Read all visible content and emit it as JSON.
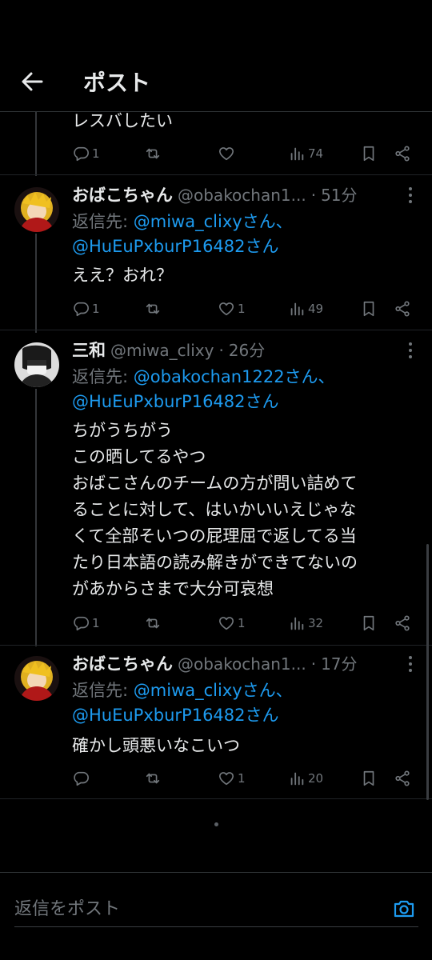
{
  "header": {
    "title": "ポスト"
  },
  "top_post": {
    "text": "レスバしたい",
    "replies": "1",
    "reposts": "",
    "likes": "",
    "views": "74"
  },
  "tweets": [
    {
      "name": "おばこちゃん",
      "handle": "@obakochan1...",
      "time": "51分",
      "reply_label": "返信先: ",
      "reply_mentions": [
        "@miwa_clixyさん、",
        "@HuEuPxburP16482さん"
      ],
      "text": "ええ？おれ？",
      "replies": "1",
      "reposts": "",
      "likes": "1",
      "views": "49"
    },
    {
      "name": "三和",
      "handle": "@miwa_clixy",
      "time": "26分",
      "reply_label": "返信先: ",
      "reply_mentions": [
        "@obakochan1222さん、",
        "@HuEuPxburP16482さん"
      ],
      "text": "ちがうちがう\nこの晒してるやつ\nおばこさんのチームの方が問い詰めて\nることに対して、はいかいいえじゃな\nくて全部そいつの屁理屈で返してる当\nたり日本語の読み解きができてないの\nがあからさまで大分可哀想",
      "replies": "1",
      "reposts": "",
      "likes": "1",
      "views": "32"
    },
    {
      "name": "おばこちゃん",
      "handle": "@obakochan1...",
      "time": "17分",
      "reply_label": "返信先: ",
      "reply_mentions": [
        "@miwa_clixyさん、",
        "@HuEuPxburP16482さん"
      ],
      "text": "確かし頭悪いなこいつ",
      "replies": "",
      "reposts": "",
      "likes": "1",
      "views": "20"
    }
  ],
  "reply_bar": {
    "placeholder": "返信をポスト"
  },
  "colors": {
    "background": "#000000",
    "text": "#e7e9ea",
    "muted": "#71767b",
    "accent": "#1d9bf0"
  }
}
